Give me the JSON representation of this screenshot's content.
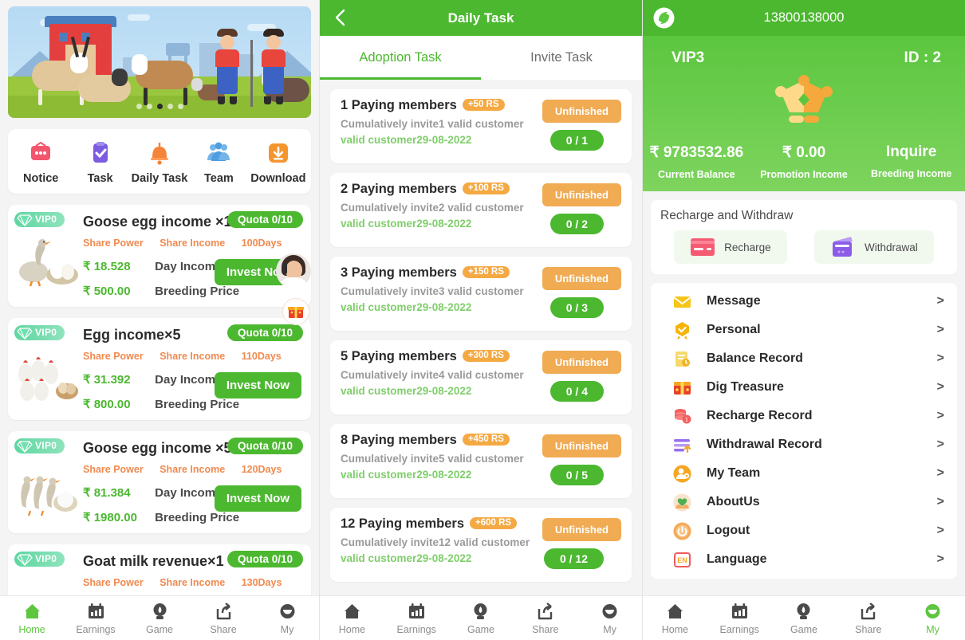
{
  "left": {
    "hero": {
      "name": "farm-banner",
      "dots": 5,
      "active_dot": 3
    },
    "quick_actions": [
      {
        "label": "Notice",
        "icon": "notice-icon",
        "color": "#f2566e"
      },
      {
        "label": "Task",
        "icon": "task-icon",
        "color": "#7c5ce0"
      },
      {
        "label": "Daily Task",
        "icon": "bell-icon",
        "color": "#f5833a"
      },
      {
        "label": "Team",
        "icon": "team-icon",
        "color": "#4f9fe0"
      },
      {
        "label": "Download",
        "icon": "download-icon",
        "color": "#f5952e"
      }
    ],
    "products": [
      {
        "vip": "VIP0",
        "title": "Goose egg income ×1",
        "quota": "Quota 0/10",
        "share_power": "Share Power",
        "share_income": "Share Income",
        "days": "100Days",
        "day_income_amount": "₹ 18.528",
        "day_income_label": "Day Income",
        "breeding_amount": "₹ 500.00",
        "breeding_label": "Breeding Price",
        "cta": "Invest Now",
        "thumb": "goose-egg-thumb"
      },
      {
        "vip": "VIP0",
        "title": "Egg income×5",
        "quota": "Quota 0/10",
        "share_power": "Share Power",
        "share_income": "Share Income",
        "days": "110Days",
        "day_income_amount": "₹ 31.392",
        "day_income_label": "Day Income",
        "breeding_amount": "₹ 800.00",
        "breeding_label": "Breeding Price",
        "cta": "Invest Now",
        "thumb": "hens-thumb"
      },
      {
        "vip": "VIP0",
        "title": "Goose egg income ×5",
        "quota": "Quota 0/10",
        "share_power": "Share Power",
        "share_income": "Share Income",
        "days": "120Days",
        "day_income_amount": "₹ 81.384",
        "day_income_label": "Day Income",
        "breeding_amount": "₹ 1980.00",
        "breeding_label": "Breeding Price",
        "cta": "Invest Now",
        "thumb": "geese-thumb"
      },
      {
        "vip": "VIP0",
        "title": "Goat milk revenue×1",
        "quota": "Quota 0/10",
        "share_power": "Share Power",
        "share_income": "Share Income",
        "days": "130Days",
        "day_income_amount": "",
        "day_income_label": "",
        "breeding_amount": "",
        "breeding_label": "",
        "cta": "",
        "thumb": "goat-thumb"
      }
    ],
    "floating": {
      "support": "customer-service-avatar",
      "gift": "gift-icon"
    },
    "bottom_nav": [
      {
        "label": "Home",
        "icon": "home-icon",
        "active": true
      },
      {
        "label": "Earnings",
        "icon": "earnings-icon",
        "active": false
      },
      {
        "label": "Game",
        "icon": "game-icon",
        "active": false
      },
      {
        "label": "Share",
        "icon": "share-icon",
        "active": false
      },
      {
        "label": "My",
        "icon": "my-icon",
        "active": false
      }
    ]
  },
  "mid": {
    "header_title": "Daily Task",
    "back_icon": "back-chevron-icon",
    "tabs": [
      {
        "label": "Adoption Task",
        "active": true
      },
      {
        "label": "Invite Task",
        "active": false
      }
    ],
    "tasks": [
      {
        "title": "1 Paying members",
        "reward": "+50 RS",
        "desc": "Cumulatively invite1 valid customer",
        "valid": "valid customer29-08-2022",
        "status": "Unfinished",
        "progress": "0 / 1"
      },
      {
        "title": "2 Paying members",
        "reward": "+100 RS",
        "desc": "Cumulatively invite2 valid customer",
        "valid": "valid customer29-08-2022",
        "status": "Unfinished",
        "progress": "0 / 2"
      },
      {
        "title": "3 Paying members",
        "reward": "+150 RS",
        "desc": "Cumulatively invite3 valid customer",
        "valid": "valid customer29-08-2022",
        "status": "Unfinished",
        "progress": "0 / 3"
      },
      {
        "title": "5 Paying members",
        "reward": "+300 RS",
        "desc": "Cumulatively invite4 valid customer",
        "valid": "valid customer29-08-2022",
        "status": "Unfinished",
        "progress": "0 / 4"
      },
      {
        "title": "8 Paying members",
        "reward": "+450 RS",
        "desc": "Cumulatively invite5 valid customer",
        "valid": "valid customer29-08-2022",
        "status": "Unfinished",
        "progress": "0 / 5"
      },
      {
        "title": "12 Paying members",
        "reward": "+600 RS",
        "desc": "Cumulatively invite12 valid customer",
        "valid": "valid customer29-08-2022",
        "status": "Unfinished",
        "progress": "0 / 12"
      }
    ],
    "bottom_nav": [
      {
        "label": "Home",
        "icon": "home-icon",
        "active": false
      },
      {
        "label": "Earnings",
        "icon": "earnings-icon",
        "active": false
      },
      {
        "label": "Game",
        "icon": "game-icon",
        "active": false
      },
      {
        "label": "Share",
        "icon": "share-icon",
        "active": false
      },
      {
        "label": "My",
        "icon": "my-icon",
        "active": false
      }
    ]
  },
  "right": {
    "logo": "brand-logo",
    "phone": "13800138000",
    "vip_level": "VIP3",
    "user_id": "ID : 2",
    "crown": "crown-icon",
    "stats": [
      {
        "value": "₹ 9783532.86",
        "label": "Current Balance"
      },
      {
        "value": "₹ 0.00",
        "label": "Promotion Income"
      },
      {
        "value": "Inquire",
        "label": "Breeding Income"
      }
    ],
    "recharge_withdraw": {
      "title": "Recharge and Withdraw",
      "buttons": [
        {
          "label": "Recharge",
          "icon": "credit-card-icon",
          "color": "#f45b72"
        },
        {
          "label": "Withdrawal",
          "icon": "wallet-icon",
          "color": "#8c5ce8"
        }
      ]
    },
    "menu": [
      {
        "label": "Message",
        "icon": "envelope-icon",
        "color": "#f5c518"
      },
      {
        "label": "Personal",
        "icon": "badge-icon",
        "color": "#f5b40a"
      },
      {
        "label": "Balance Record",
        "icon": "receipt-icon",
        "color": "#f7d96b"
      },
      {
        "label": "Dig Treasure",
        "icon": "treasure-icon",
        "color": "#e8402a"
      },
      {
        "label": "Recharge Record",
        "icon": "coins-icon",
        "color": "#f2615f"
      },
      {
        "label": "Withdrawal Record",
        "icon": "withdraw-list-icon",
        "color": "#9a6ef0"
      },
      {
        "label": "My Team",
        "icon": "user-gear-icon",
        "color": "#f5a623"
      },
      {
        "label": "AboutUs",
        "icon": "hands-heart-icon",
        "color": "#f0d7b0"
      },
      {
        "label": "Logout",
        "icon": "power-icon",
        "color": "#f3a957"
      },
      {
        "label": "Language",
        "icon": "language-en-icon",
        "color": "#ef5c5c"
      }
    ],
    "chevron": ">",
    "bottom_nav": [
      {
        "label": "Home",
        "icon": "home-icon",
        "active": false
      },
      {
        "label": "Earnings",
        "icon": "earnings-icon",
        "active": false
      },
      {
        "label": "Game",
        "icon": "game-icon",
        "active": false
      },
      {
        "label": "Share",
        "icon": "share-icon",
        "active": false
      },
      {
        "label": "My",
        "icon": "my-icon",
        "active": true
      }
    ]
  }
}
